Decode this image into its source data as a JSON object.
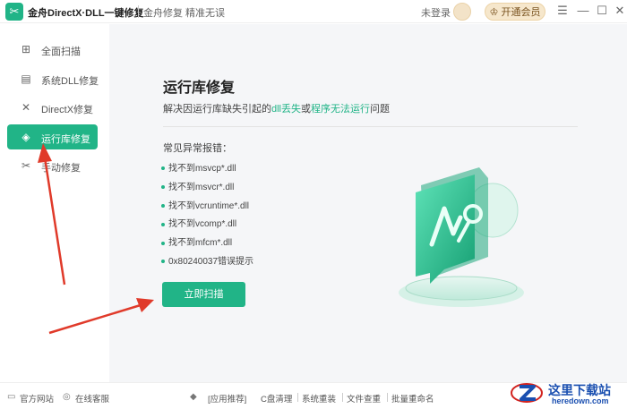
{
  "titlebar": {
    "app_title": "金舟DirectX·DLL一键修复",
    "slogan": "金舟修复 精准无误",
    "login_status": "未登录",
    "vip_label": "开通会员",
    "menu_glyph": "☰",
    "minimize_glyph": "—",
    "maximize_glyph": "☐",
    "close_glyph": "✕"
  },
  "sidebar": {
    "items": [
      {
        "label": "全面扫描",
        "icon": "scan-icon",
        "glyph": "⊞"
      },
      {
        "label": "系统DLL修复",
        "icon": "dll-icon",
        "glyph": "▤"
      },
      {
        "label": "DirectX修复",
        "icon": "directx-icon",
        "glyph": "✕"
      },
      {
        "label": "运行库修复",
        "icon": "runtime-icon",
        "glyph": "◈",
        "active": true
      },
      {
        "label": "手动修复",
        "icon": "wrench-icon",
        "glyph": "✂"
      }
    ]
  },
  "main": {
    "title": "运行库修复",
    "desc_pre": "解决因运行库缺失引起的",
    "desc_hl1": "dll丢失",
    "desc_mid": "或",
    "desc_hl2": "程序无法运行",
    "desc_post": "问题",
    "err_title": "常见异常报错：",
    "errors": [
      "找不到msvcp*.dll",
      "找不到msvcr*.dll",
      "找不到vcruntime*.dll",
      "找不到vcomp*.dll",
      "找不到mfcm*.dll",
      "0x80240037错误提示"
    ],
    "scan_button": "立即扫描"
  },
  "footer": {
    "website": "官方网站",
    "support": "在线客服",
    "recommend": "[应用推荐]",
    "links": [
      "C盘清理",
      "系统重装",
      "文件查重",
      "批量重命名"
    ]
  },
  "watermark": {
    "text": "这里下载站",
    "sub": "heredown.com"
  },
  "colors": {
    "accent": "#21b487",
    "annotation_arrow": "#e03a2a"
  }
}
